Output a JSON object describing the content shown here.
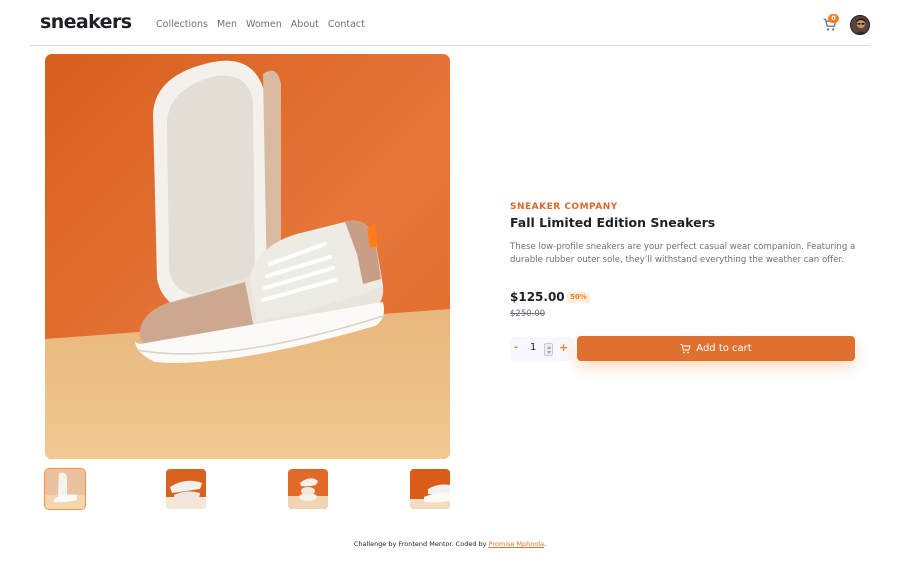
{
  "header": {
    "logo": "sneakers",
    "nav": [
      "Collections",
      "Men",
      "Women",
      "About",
      "Contact"
    ],
    "cart_count": "0",
    "cart_icon": "cart-icon",
    "avatar_icon": "avatar"
  },
  "product": {
    "company": "SNEAKER COMPANY",
    "title": "Fall Limited Edition Sneakers",
    "description": "These low-profile sneakers are your perfect casual wear companion. Featuring a durable rubber outer sole, they’ll withstand everything the weather can offer.",
    "price": "$125.00",
    "discount": "50%",
    "old_price": "$250.00"
  },
  "cart_controls": {
    "minus": "-",
    "quantity": "1",
    "plus": "+",
    "add_label": "Add to cart"
  },
  "footer": {
    "prefix": "Challenge by Frontend Mentor. Coded by ",
    "author": "Promise Mphoola",
    "suffix": "."
  },
  "colors": {
    "accent": "#ff7e1b",
    "button": "#e0702f",
    "dark": "#1d2026",
    "muted": "#69707d"
  }
}
